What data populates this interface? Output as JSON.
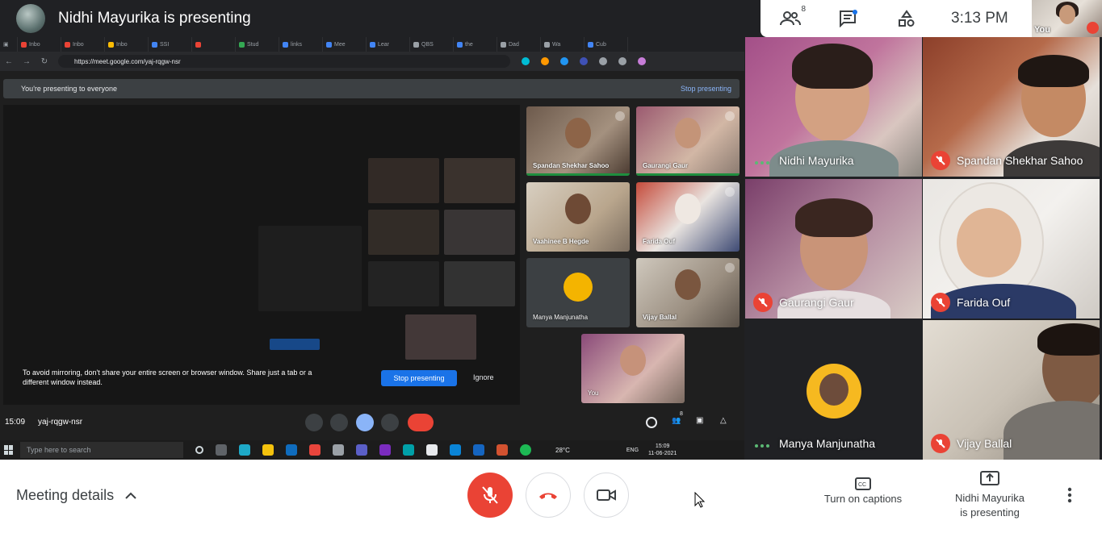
{
  "header": {
    "presenting_title": "Nidhi Mayurika is presenting",
    "people_count": "8",
    "clock": "3:13 PM",
    "self_label": "You"
  },
  "shared_screen": {
    "tabs": [
      {
        "label": "Inbo",
        "color": "#ea4335"
      },
      {
        "label": "Inbo",
        "color": "#ea4335"
      },
      {
        "label": "Inbo",
        "color": "#fbbc04"
      },
      {
        "label": "SSI",
        "color": "#4285f4"
      },
      {
        "label": "",
        "color": "#ea4335"
      },
      {
        "label": "Stud",
        "color": "#34a853"
      },
      {
        "label": "links",
        "color": "#4285f4"
      },
      {
        "label": "Mee",
        "color": "#4285f4"
      },
      {
        "label": "Lear",
        "color": "#4285f4"
      },
      {
        "label": "QBS",
        "color": "#9aa0a6"
      },
      {
        "label": "the",
        "color": "#4285f4"
      },
      {
        "label": "Dad",
        "color": "#9aa0a6"
      },
      {
        "label": "Wa",
        "color": "#9aa0a6"
      },
      {
        "label": "Cub",
        "color": "#4285f4"
      }
    ],
    "url": "https://meet.google.com/yaj-rqgw-nsr",
    "banner_text": "You're presenting to everyone",
    "banner_stop": "Stop presenting",
    "warning_text": "To avoid mirroring, don't share your entire screen or browser window. Share just a tab or a different window instead.",
    "stop_button": "Stop presenting",
    "ignore_button": "Ignore",
    "time": "15:09",
    "meeting_code": "yaj-rqgw-nsr",
    "inner_people_count": "8",
    "inner_tiles": [
      {
        "name": "Spandan Shekhar Sahoo"
      },
      {
        "name": "Gaurangi Gaur"
      },
      {
        "name": "Vaahinee B Hegde"
      },
      {
        "name": "Farida Ouf"
      },
      {
        "name": "Manya Manjunatha"
      },
      {
        "name": "Vijay Ballal"
      },
      {
        "name": "You"
      }
    ],
    "taskbar": {
      "search_placeholder": "Type here to search",
      "temperature": "28°C",
      "language": "ENG",
      "clock_time": "15:09",
      "clock_date": "11-06-2021"
    }
  },
  "participants": [
    {
      "name": "Nidhi Mayurika",
      "state": "speaking"
    },
    {
      "name": "Spandan Shekhar Sahoo",
      "state": "muted"
    },
    {
      "name": "Gaurangi Gaur",
      "state": "muted"
    },
    {
      "name": "Farida Ouf",
      "state": "muted"
    },
    {
      "name": "Manya Manjunatha",
      "state": "speaking"
    },
    {
      "name": "Vijay Ballal",
      "state": "muted"
    }
  ],
  "bottom_bar": {
    "meeting_details": "Meeting details",
    "captions": "Turn on captions",
    "presenting_line1": "Nidhi Mayurika",
    "presenting_line2": "is presenting"
  }
}
